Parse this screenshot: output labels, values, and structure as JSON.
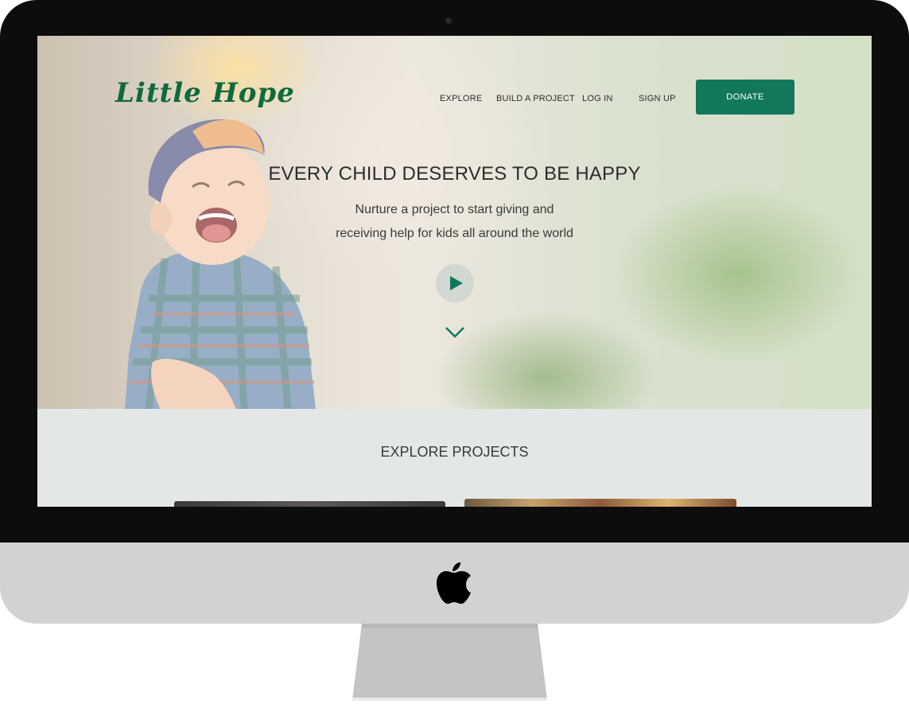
{
  "site": {
    "logo_text": "Little Hope",
    "brand_color": "#0f6a3c",
    "accent_color": "#13775c"
  },
  "nav": {
    "explore": "EXPLORE",
    "build_project": "BUILD A PROJECT",
    "log_in": "LOG IN",
    "sign_up": "SIGN UP",
    "donate": "DONATE"
  },
  "hero": {
    "headline": "EVERY CHILD DESERVES TO BE HAPPY",
    "subline_1": "Nurture a project to start giving and",
    "subline_2": "receiving help for kids all around the world",
    "play_icon": "play-icon",
    "scroll_icon": "chevron-down-icon"
  },
  "explore": {
    "title": "EXPLORE PROJECTS"
  },
  "device": {
    "logo_icon": "apple-logo-icon"
  }
}
